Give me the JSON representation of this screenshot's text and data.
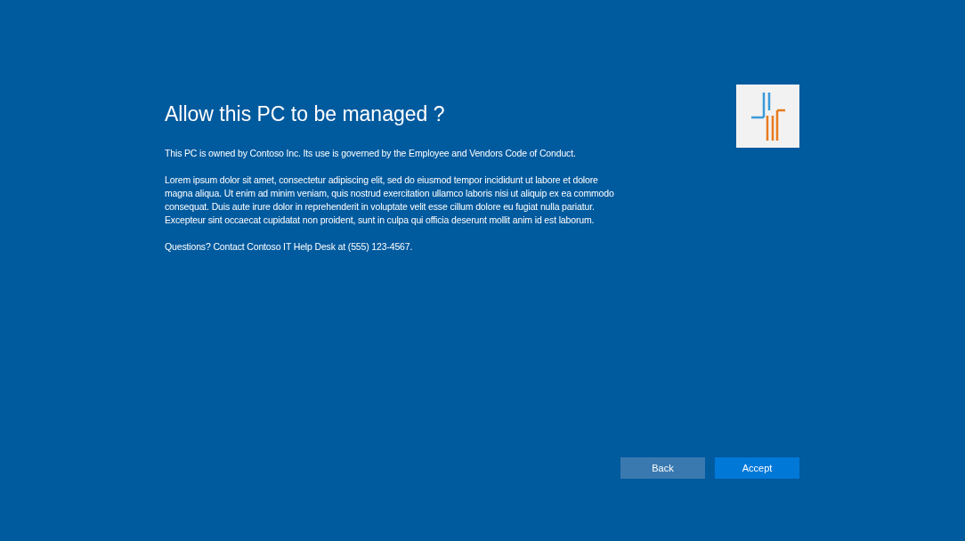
{
  "title": "Allow this PC to be managed ?",
  "paragraphs": [
    "This PC is owned by Contoso Inc. Its use is governed by the Employee and Vendors Code of Conduct.",
    "Lorem ipsum dolor sit amet, consectetur adipiscing elit, sed do eiusmod tempor incididunt ut labore et dolore magna aliqua. Ut enim ad minim veniam, quis nostrud exercitation ullamco laboris nisi ut aliquip ex ea commodo consequat. Duis aute irure dolor in reprehenderit in voluptate velit esse cillum dolore eu fugiat nulla pariatur. Excepteur sint occaecat cupidatat non proident, sunt in culpa qui officia deserunt mollit anim id est laborum.",
    "Questions? Contact Contoso IT Help Desk at (555) 123-4567."
  ],
  "buttons": [
    {
      "label": "Back",
      "kind": "secondary"
    },
    {
      "label": "Accept",
      "kind": "primary"
    }
  ]
}
